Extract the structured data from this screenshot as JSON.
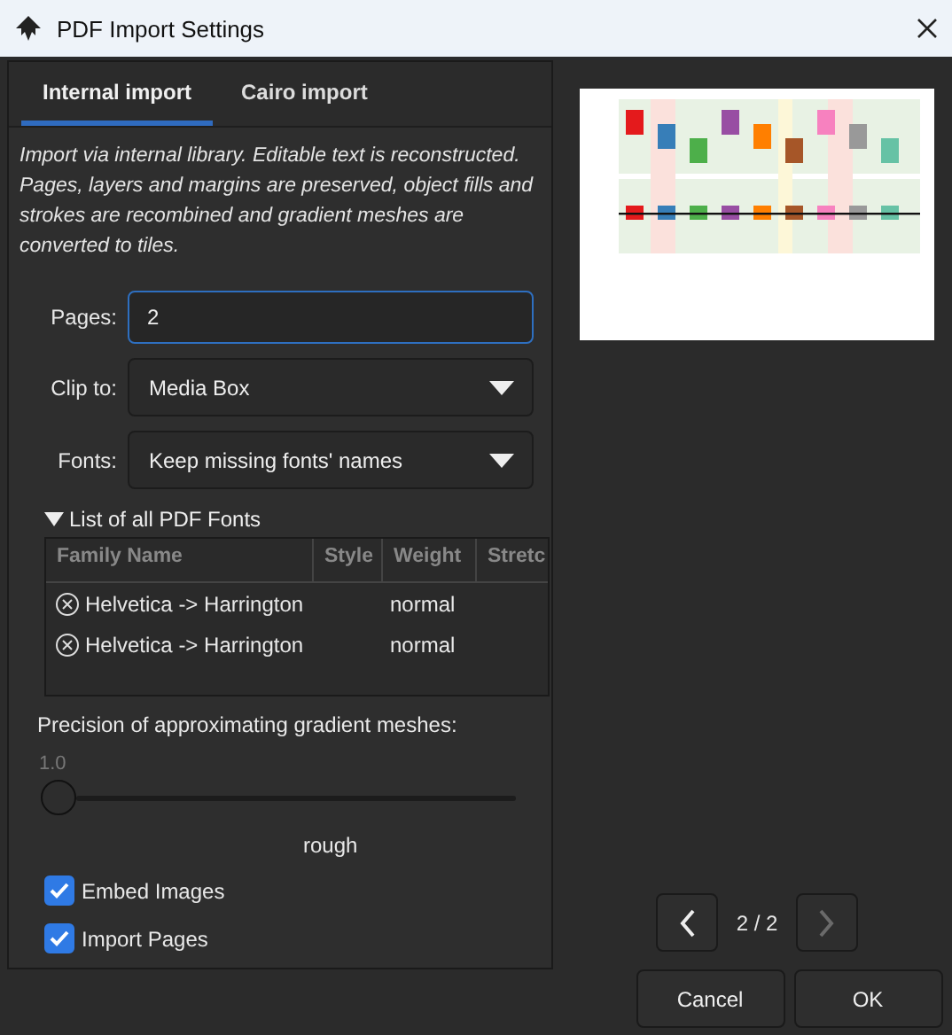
{
  "window": {
    "title": "PDF Import Settings"
  },
  "tabs": [
    {
      "label": "Internal import",
      "selected": true
    },
    {
      "label": "Cairo import",
      "selected": false
    }
  ],
  "description": "Import via internal library. Editable text is reconstructed. Pages, layers and margins are preserved, object fills and strokes are recombined and gradient meshes are converted to tiles.",
  "pages": {
    "label": "Pages:",
    "value": "2"
  },
  "clip": {
    "label": "Clip to:",
    "value": "Media Box"
  },
  "fonts": {
    "label": "Fonts:",
    "value": "Keep missing fonts' names"
  },
  "font_list": {
    "label": "List of all PDF Fonts",
    "expanded": true,
    "columns": [
      "Family Name",
      "Style",
      "Weight",
      "Stretc"
    ],
    "rows": [
      {
        "family": "Helvetica -> Harrington",
        "weight": "normal"
      },
      {
        "family": "Helvetica -> Harrington",
        "weight": "normal"
      }
    ]
  },
  "precision": {
    "label": "Precision of approximating gradient meshes:",
    "reading": "1.0",
    "level": 0,
    "caption": "rough"
  },
  "checkboxes": [
    {
      "label": "Embed Images",
      "checked": true
    },
    {
      "label": "Import Pages",
      "checked": true
    }
  ],
  "pager": {
    "text": "2 / 2",
    "prev_disabled": false,
    "next_disabled": true
  },
  "buttons": [
    "Cancel",
    "OK"
  ]
}
